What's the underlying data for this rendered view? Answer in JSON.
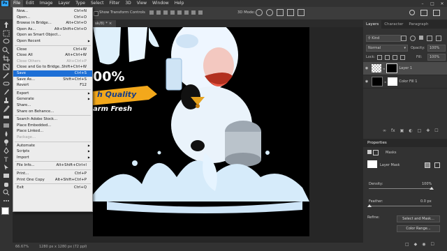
{
  "menubar": {
    "logo": "Ps",
    "items": [
      "File",
      "Edit",
      "Image",
      "Layer",
      "Type",
      "Select",
      "Filter",
      "3D",
      "View",
      "Window",
      "Help"
    ]
  },
  "options_bar": {
    "transform_label": "Show Transform Controls",
    "mode_3d": "3D Mode:"
  },
  "document_tab": {
    "label": "sk/8) *"
  },
  "file_menu": {
    "groups": [
      [
        {
          "label": "New...",
          "shortcut": "Ctrl+N"
        },
        {
          "label": "Open...",
          "shortcut": "Ctrl+O"
        },
        {
          "label": "Browse in Bridge...",
          "shortcut": "Alt+Ctrl+O"
        },
        {
          "label": "Open As...",
          "shortcut": "Alt+Shift+Ctrl+O"
        },
        {
          "label": "Open as Smart Object...",
          "shortcut": ""
        },
        {
          "label": "Open Recent",
          "shortcut": "",
          "submenu": true
        }
      ],
      [
        {
          "label": "Close",
          "shortcut": "Ctrl+W"
        },
        {
          "label": "Close All",
          "shortcut": "Alt+Ctrl+W"
        },
        {
          "label": "Close Others",
          "shortcut": "Alt+Ctrl+P",
          "disabled": true
        },
        {
          "label": "Close and Go to Bridge...",
          "shortcut": "Shift+Ctrl+W"
        },
        {
          "label": "Save",
          "shortcut": "Ctrl+S",
          "highlighted": true
        },
        {
          "label": "Save As...",
          "shortcut": "Shift+Ctrl+S"
        },
        {
          "label": "Revert",
          "shortcut": "F12"
        }
      ],
      [
        {
          "label": "Export",
          "shortcut": "",
          "submenu": true
        },
        {
          "label": "Generate",
          "shortcut": "",
          "submenu": true
        },
        {
          "label": "Share...",
          "shortcut": ""
        },
        {
          "label": "Share on Behance...",
          "shortcut": ""
        }
      ],
      [
        {
          "label": "Search Adobe Stock...",
          "shortcut": ""
        },
        {
          "label": "Place Embedded...",
          "shortcut": ""
        },
        {
          "label": "Place Linked...",
          "shortcut": ""
        },
        {
          "label": "Package...",
          "shortcut": "",
          "disabled": true
        }
      ],
      [
        {
          "label": "Automate",
          "shortcut": "",
          "submenu": true
        },
        {
          "label": "Scripts",
          "shortcut": "",
          "submenu": true
        },
        {
          "label": "Import",
          "shortcut": "",
          "submenu": true
        }
      ],
      [
        {
          "label": "File Info...",
          "shortcut": "Alt+Shift+Ctrl+I"
        }
      ],
      [
        {
          "label": "Print...",
          "shortcut": "Ctrl+P"
        },
        {
          "label": "Print One Copy",
          "shortcut": "Alt+Shift+Ctrl+P"
        }
      ],
      [
        {
          "label": "Exit",
          "shortcut": "Ctrl+Q"
        }
      ]
    ]
  },
  "canvas_text": {
    "percent": "00%",
    "ribbon": "h Quality",
    "tagline": "arm Fresh"
  },
  "layers_panel": {
    "tabs": [
      "Layers",
      "Character",
      "Paragraph"
    ],
    "kind_label": "Kind",
    "blend_mode": "Normal",
    "opacity_label": "Opacity:",
    "opacity_value": "100%",
    "lock_label": "Lock:",
    "fill_label": "Fill:",
    "fill_value": "100%",
    "layers": [
      {
        "name": "Layer 1",
        "selected": true
      },
      {
        "name": "Color Fill 1",
        "selected": false
      }
    ]
  },
  "properties_panel": {
    "title": "Properties",
    "section": "Masks",
    "mask_label": "Layer Mask",
    "density_label": "Density:",
    "density_value": "100%",
    "feather_label": "Feather:",
    "feather_value": "0.0 px",
    "refine_label": "Refine:",
    "select_mask_button": "Select and Mask...",
    "color_range_button": "Color Range..."
  },
  "status_bar": {
    "zoom": "66.67%",
    "doc_size": "1280 px x 1280 px (72 ppi)"
  },
  "colors": {
    "accent": "#1d6fd6",
    "panel": "#323232",
    "menubar": "#323232"
  }
}
